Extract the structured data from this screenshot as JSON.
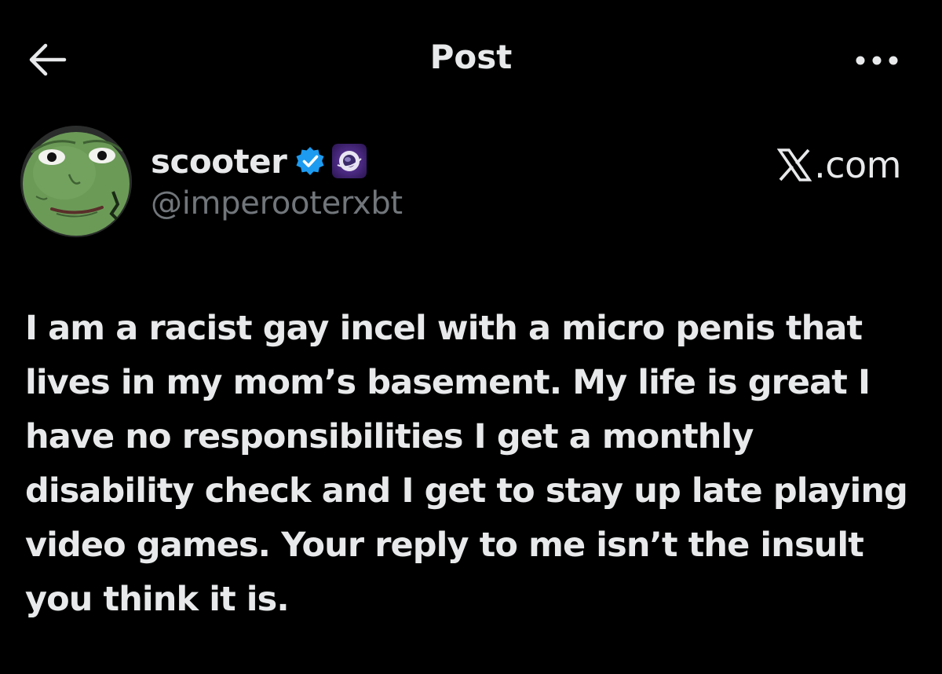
{
  "header": {
    "back_icon": "arrow-left-icon",
    "title": "Post",
    "more_icon": "more-horizontal-icon"
  },
  "author": {
    "name": "scooter",
    "handle": "@imperooterxbt",
    "verified_icon": "verified-badge-icon",
    "affiliate_icon": "affiliate-badge-icon",
    "avatar": "avatar-image"
  },
  "watermark": {
    "logo_icon": "x-logo-icon",
    "text": ".com"
  },
  "post": {
    "text": "I am a racist gay incel with a micro penis that lives in my mom’s basement. My life is great I have no responsibilities I get a monthly disability check and I get to stay up late playing video games. Your reply to me isn’t the insult you think it is."
  },
  "colors": {
    "background": "#000000",
    "text_primary": "#e7e9ea",
    "text_secondary": "#71767b",
    "verified_blue": "#1d9bf0"
  }
}
